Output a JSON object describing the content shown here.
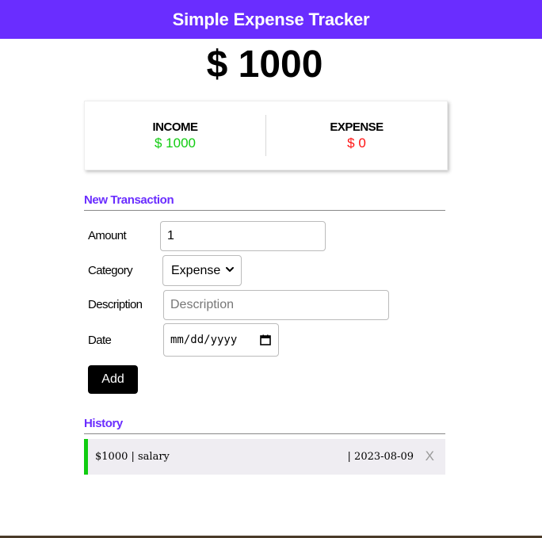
{
  "header": {
    "title": "Simple Expense Tracker"
  },
  "balance": {
    "display": "$ 1000"
  },
  "summary": {
    "income_label": "INCOME",
    "income_value": "$ 1000",
    "expense_label": "EXPENSE",
    "expense_value": "$ 0"
  },
  "new_transaction": {
    "title": "New Transaction",
    "amount_label": "Amount",
    "amount_value": "1",
    "category_label": "Category",
    "category_selected": "Expense",
    "description_label": "Description",
    "description_placeholder": "Description",
    "date_label": "Date",
    "date_placeholder": "mm/dd/yyyy",
    "add_label": "Add"
  },
  "history": {
    "title": "History",
    "items": [
      {
        "amount_category": "$1000 | salary",
        "date_text": "| 2023-08-09",
        "type": "income",
        "delete_label": "X"
      }
    ]
  },
  "colors": {
    "accent": "#6a2dff",
    "income": "#11cc11",
    "expense": "#ff1111"
  },
  "icons": {
    "category_dropdown": "chevron-down-icon",
    "date_picker": "calendar-icon"
  }
}
